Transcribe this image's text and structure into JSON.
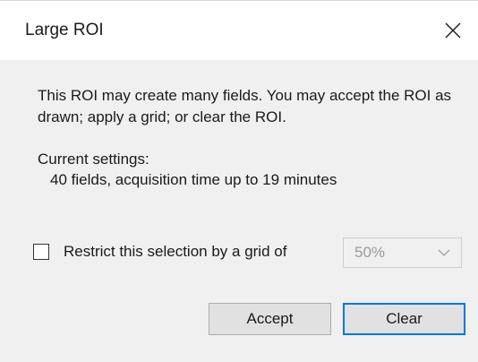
{
  "window": {
    "title": "Large ROI",
    "close_icon": "close-icon"
  },
  "message": {
    "text": "This ROI may create many fields. You may accept the ROI as drawn; apply a grid; or clear the ROI."
  },
  "settings": {
    "label": "Current settings:",
    "value": "40 fields, acquisition time up to 19 minutes"
  },
  "grid": {
    "checkbox_label": "Restrict this selection by a grid of",
    "checked": false,
    "selected_value": "50%",
    "disabled": true
  },
  "buttons": {
    "accept_label": "Accept",
    "clear_label": "Clear"
  },
  "colors": {
    "focus_border": "#0078d7",
    "body_background": "#f0f0f0",
    "disabled_text": "#9a9a9a"
  }
}
